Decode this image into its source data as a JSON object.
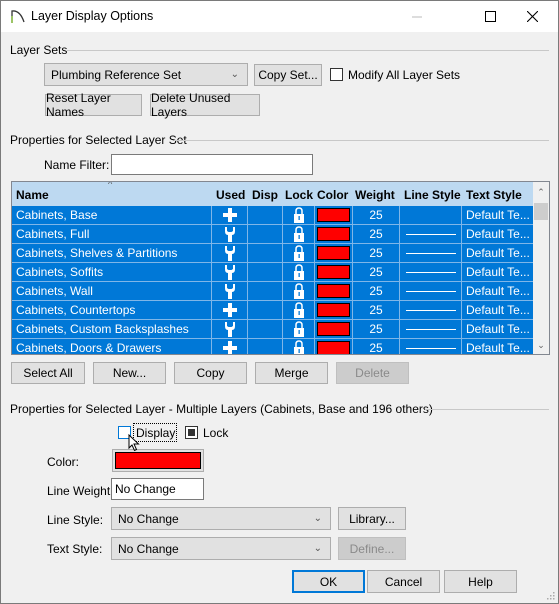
{
  "window": {
    "title": "Layer Display Options",
    "icon": "chief-architect-arc-icon",
    "controls": [
      "minimize-icon",
      "maximize-icon",
      "close-icon"
    ]
  },
  "layer_sets": {
    "group_label": "Layer Sets",
    "selected_set": "Plumbing Reference Set",
    "copy_set_label": "Copy Set...",
    "modify_all_label": "Modify All Layer Sets",
    "modify_all_checked": false,
    "reset_names_label": "Reset Layer Names",
    "delete_unused_label": "Delete Unused Layers"
  },
  "set_properties": {
    "group_label": "Properties for Selected Layer Set",
    "name_filter_label": "Name Filter:",
    "name_filter_value": ""
  },
  "table": {
    "columns": [
      "Name",
      "Used",
      "Disp",
      "Lock",
      "Color",
      "Weight",
      "Line Style",
      "Text Style"
    ],
    "sort_indicator": "^",
    "rows": [
      {
        "name": "Cabinets,  Base",
        "used": "plus",
        "disp": "",
        "lock": "lock",
        "color": "#ff0000",
        "weight": "25",
        "line_style": "",
        "text_style": "Default Te..."
      },
      {
        "name": "Cabinets,  Full",
        "used": "wrench",
        "disp": "",
        "lock": "lock",
        "color": "#ff0000",
        "weight": "25",
        "line_style": "solid",
        "text_style": "Default Te..."
      },
      {
        "name": "Cabinets,  Shelves & Partitions",
        "used": "wrench",
        "disp": "",
        "lock": "lock",
        "color": "#ff0000",
        "weight": "25",
        "line_style": "solid",
        "text_style": "Default Te..."
      },
      {
        "name": "Cabinets,  Soffits",
        "used": "wrench",
        "disp": "",
        "lock": "lock",
        "color": "#ff0000",
        "weight": "25",
        "line_style": "solid",
        "text_style": "Default Te..."
      },
      {
        "name": "Cabinets,  Wall",
        "used": "wrench",
        "disp": "",
        "lock": "lock",
        "color": "#ff0000",
        "weight": "25",
        "line_style": "solid",
        "text_style": "Default Te..."
      },
      {
        "name": "Cabinets, Countertops",
        "used": "plus",
        "disp": "",
        "lock": "lock",
        "color": "#ff0000",
        "weight": "25",
        "line_style": "solid",
        "text_style": "Default Te..."
      },
      {
        "name": "Cabinets, Custom Backsplashes",
        "used": "wrench",
        "disp": "",
        "lock": "lock",
        "color": "#ff0000",
        "weight": "25",
        "line_style": "solid",
        "text_style": "Default Te..."
      },
      {
        "name": "Cabinets, Doors & Drawers",
        "used": "plus",
        "disp": "",
        "lock": "lock",
        "color": "#ff0000",
        "weight": "25",
        "line_style": "solid",
        "text_style": "Default Te..."
      }
    ],
    "selection_color": "#0078d7",
    "header_color": "#bdd9f1"
  },
  "table_buttons": {
    "select_all": "Select All",
    "new": "New...",
    "copy": "Copy",
    "merge": "Merge",
    "delete": "Delete"
  },
  "layer_properties": {
    "group_label": "Properties for Selected Layer - Multiple Layers (Cabinets,  Base and 196 others)",
    "display_label": "Display",
    "display_checked": false,
    "lock_label": "Lock",
    "lock_state": "indeterminate",
    "color_label": "Color:",
    "color_value": "#ff0000",
    "line_weight_label": "Line Weight:",
    "line_weight_value": "No Change",
    "line_style_label": "Line Style:",
    "line_style_value": "No Change",
    "library_label": "Library...",
    "text_style_label": "Text Style:",
    "text_style_value": "No Change",
    "define_label": "Define..."
  },
  "footer": {
    "ok": "OK",
    "cancel": "Cancel",
    "help": "Help"
  }
}
